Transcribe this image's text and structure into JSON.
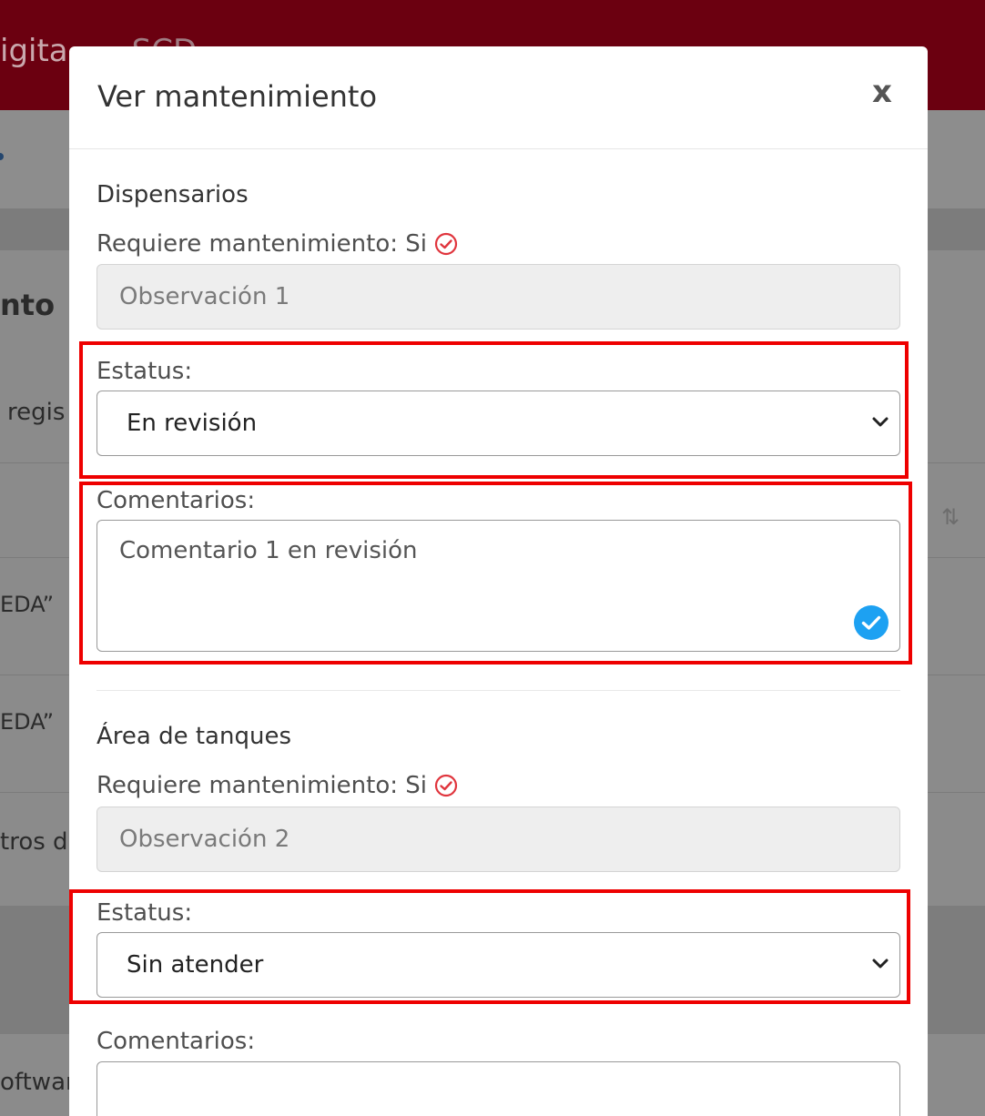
{
  "background": {
    "brand_text": "igita",
    "brand_extra": "SCD",
    "heading_fragment": "nto",
    "records_fragment": "regis",
    "row_1_fragment": "EDA”",
    "row_2_fragment": "EDA”",
    "footer_fragment": "tros d",
    "bottom_fragment": "oftwar"
  },
  "modal": {
    "title": "Ver mantenimiento",
    "close_label": "x",
    "sections": [
      {
        "title": "Dispensarios",
        "requires_label": "Requiere mantenimiento: Si",
        "observation": "Observación 1",
        "status_label": "Estatus:",
        "status_value": "En revisión",
        "comments_label": "Comentarios:",
        "comments_value": "Comentario 1 en revisión"
      },
      {
        "title": "Área de tanques",
        "requires_label": "Requiere mantenimiento: Si",
        "observation": "Observación 2",
        "status_label": "Estatus:",
        "status_value": "Sin atender",
        "comments_label": "Comentarios:",
        "comments_value": ""
      }
    ]
  },
  "icons": {
    "requires_check": "check-circle-icon",
    "valid": "valid-check-icon",
    "select_arrow": "chevron-down-icon"
  },
  "colors": {
    "header_bg": "#6b0010",
    "highlight": "#ee0000",
    "check_red": "#e0353d",
    "valid_blue": "#1da1f2"
  }
}
